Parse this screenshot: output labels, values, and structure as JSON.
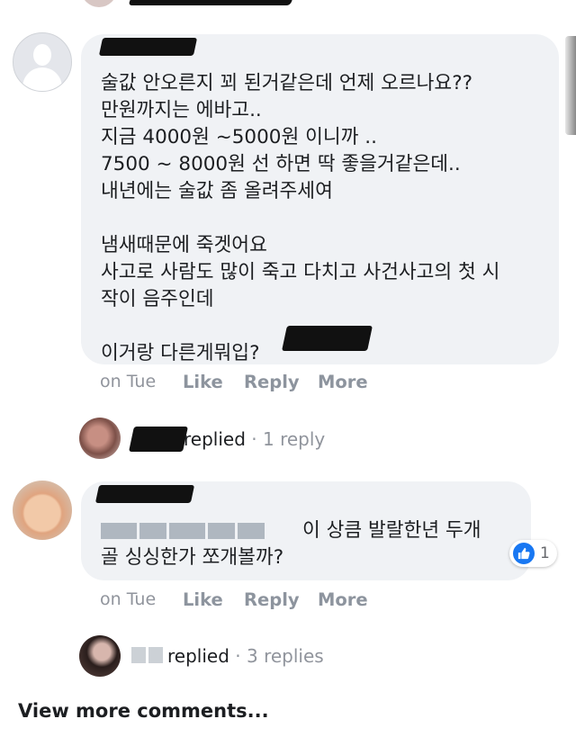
{
  "comments": [
    {
      "text": "술값 안오른지 꾀 된거같은데 언제 오르나요??\n만원까지는 에바고..\n지금 4000원 ~5000원 이니까 ..\n7500 ~ 8000원 선 하면 딱 좋을거같은데..\n내년에는 술값 좀 올려주세여\n\n냄새때문에 죽겟어요\n사고로 사람도 많이 죽고 다치고 사건사고의 첫 시\n작이 음주인데\n\n이거랑 다른게뭐입?",
      "time": "on Tue",
      "actions": [
        "Like",
        "Reply",
        "More"
      ],
      "reply_label": "replied",
      "reply_count": "· 1 reply"
    },
    {
      "text_line1": "이 상큼 발랄한년 두개",
      "text_line2": "골 싱싱한가 쪼개볼까?",
      "time": "on Tue",
      "actions": [
        "Like",
        "Reply",
        "More"
      ],
      "like_count": "1",
      "reply_label": "replied",
      "reply_count": "· 3 replies"
    }
  ],
  "footer": {
    "view_more": "View more comments..."
  },
  "icons": [
    "default-avatar-icon",
    "profile-photo-icon",
    "thumbs-up-icon"
  ],
  "colors": {
    "bubble": "#f0f2f5",
    "like_blue": "#1877f2",
    "meta_gray": "#90949c"
  }
}
